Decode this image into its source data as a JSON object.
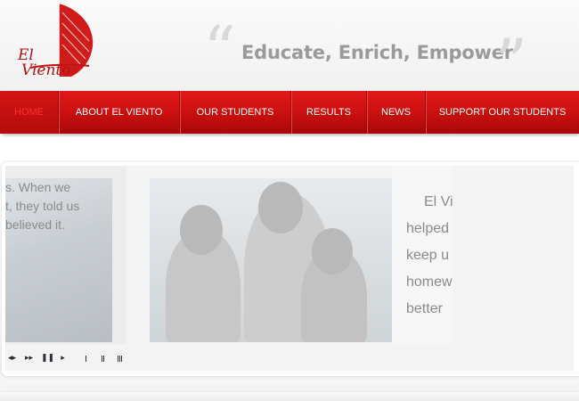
{
  "logo": {
    "line1": "El",
    "line2": "Viento",
    "mark": "®",
    "color": "#b31313"
  },
  "tagline": {
    "open_quote": "“",
    "text": "Educate, Enrich, Empower",
    "close_quote": "”"
  },
  "nav": {
    "items": [
      {
        "label": "HOME",
        "active": true
      },
      {
        "label": "ABOUT EL VIENTO",
        "active": false
      },
      {
        "label": "OUR STUDENTS",
        "active": false
      },
      {
        "label": "RESULTS",
        "active": false
      },
      {
        "label": "NEWS",
        "active": false
      },
      {
        "label": "SUPPORT OUR STUDENTS",
        "active": false
      }
    ],
    "color": "#c80f0f"
  },
  "slider": {
    "slide_left_text": [
      "s.  When we",
      "t, they told us",
      "believed it."
    ],
    "slide_right_text": [
      "El Vi",
      "helped",
      "keep u",
      "homew",
      "better"
    ],
    "controls": [
      "previous-icon",
      "play-icon",
      "pause-icon",
      "next-icon"
    ],
    "pages": [
      1,
      2,
      3
    ]
  }
}
